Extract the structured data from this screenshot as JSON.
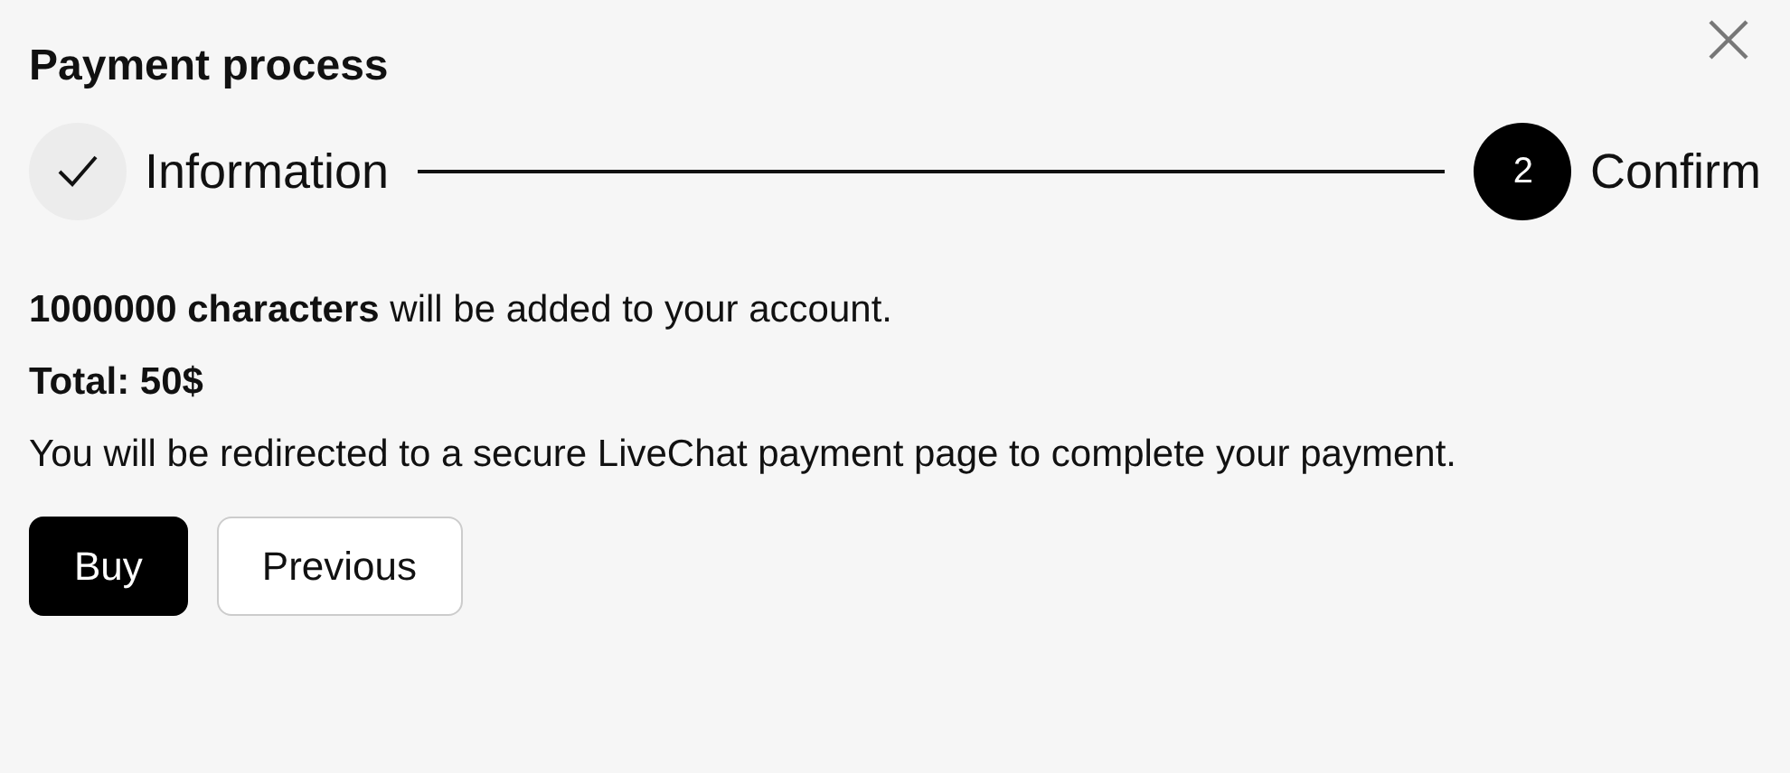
{
  "title": "Payment process",
  "steps": [
    {
      "label": "Information",
      "completed": true,
      "selected": false
    },
    {
      "label": "Confirm",
      "number": "2",
      "completed": false,
      "selected": true
    }
  ],
  "paragraphs": [
    {
      "kind": "plain",
      "text": "**1000000 characters** will be added to your account."
    },
    {
      "kind": "strong",
      "text": "Total: 50$"
    },
    {
      "kind": "plain",
      "text": "You will be redirected to a secure LiveChat payment page to complete your payment."
    }
  ],
  "buttons": [
    {
      "label": "Buy",
      "kind": "primary"
    },
    {
      "label": "Previous",
      "kind": "secondary"
    }
  ]
}
